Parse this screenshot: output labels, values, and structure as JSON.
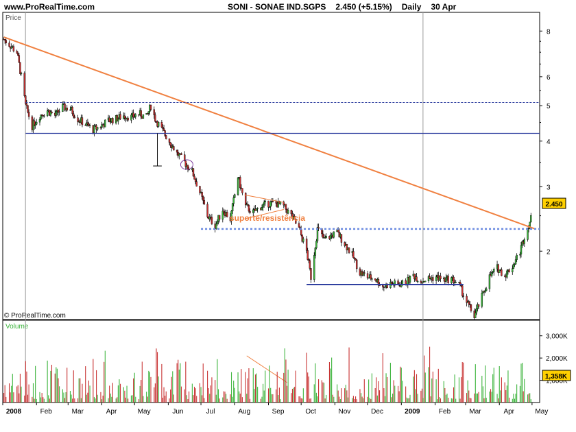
{
  "header": {
    "site": "www.ProRealTime.com",
    "ticker": "SONI - SONAE IND.SGPS",
    "price_change": "2.450 (+5.15%)",
    "period": "Daily",
    "date": "30 Apr"
  },
  "panels": {
    "price_label": "Price",
    "volume_label": "Volume",
    "watermark": "© ProRealTime.com"
  },
  "annotation": {
    "support_text": "suporte/resistência"
  },
  "colors": {
    "up": "#3cb43c",
    "down": "#c83232",
    "trendline": "#f08040",
    "support_line": "#3040a0",
    "dotted_resistance": "#6a8ae0",
    "badge": "#ffd000"
  },
  "badges": {
    "price": "2.450",
    "volume": "1,358K"
  },
  "chart_data": [
    {
      "type": "candlestick",
      "title": "SONI - SONAE IND.SGPS",
      "y_scale": "log",
      "yticks": [
        "2",
        "3",
        "4",
        "5",
        "6",
        "8"
      ],
      "ylim": [
        1.3,
        9.0
      ],
      "x_labels": [
        "2008",
        "Feb",
        "Mar",
        "Apr",
        "May",
        "Jun",
        "Jul",
        "Aug",
        "Sep",
        "Oct",
        "Nov",
        "Dec",
        "2009",
        "Feb",
        "Mar",
        "Apr",
        "May"
      ],
      "close_points": [
        {
          "date": "2008-01-02",
          "close": 7.6
        },
        {
          "date": "2008-01-08",
          "close": 7.3
        },
        {
          "date": "2008-01-14",
          "close": 7.0
        },
        {
          "date": "2008-01-18",
          "close": 6.0
        },
        {
          "date": "2008-01-22",
          "close": 5.0
        },
        {
          "date": "2008-01-28",
          "close": 4.4
        },
        {
          "date": "2008-02-04",
          "close": 4.7
        },
        {
          "date": "2008-02-11",
          "close": 4.85
        },
        {
          "date": "2008-02-18",
          "close": 4.7
        },
        {
          "date": "2008-02-25",
          "close": 4.95
        },
        {
          "date": "2008-03-03",
          "close": 4.9
        },
        {
          "date": "2008-03-10",
          "close": 4.6
        },
        {
          "date": "2008-03-17",
          "close": 4.45
        },
        {
          "date": "2008-03-24",
          "close": 4.3
        },
        {
          "date": "2008-03-31",
          "close": 4.4
        },
        {
          "date": "2008-04-07",
          "close": 4.55
        },
        {
          "date": "2008-04-14",
          "close": 4.6
        },
        {
          "date": "2008-04-21",
          "close": 4.7
        },
        {
          "date": "2008-04-28",
          "close": 4.65
        },
        {
          "date": "2008-05-05",
          "close": 4.75
        },
        {
          "date": "2008-05-12",
          "close": 4.65
        },
        {
          "date": "2008-05-16",
          "close": 5.0
        },
        {
          "date": "2008-05-20",
          "close": 4.6
        },
        {
          "date": "2008-05-26",
          "close": 4.3
        },
        {
          "date": "2008-06-02",
          "close": 4.0
        },
        {
          "date": "2008-06-09",
          "close": 3.7
        },
        {
          "date": "2008-06-16",
          "close": 3.5
        },
        {
          "date": "2008-06-23",
          "close": 3.3
        },
        {
          "date": "2008-06-30",
          "close": 2.9
        },
        {
          "date": "2008-07-07",
          "close": 2.5
        },
        {
          "date": "2008-07-14",
          "close": 2.35
        },
        {
          "date": "2008-07-21",
          "close": 2.6
        },
        {
          "date": "2008-07-28",
          "close": 2.45
        },
        {
          "date": "2008-08-04",
          "close": 3.2
        },
        {
          "date": "2008-08-11",
          "close": 2.65
        },
        {
          "date": "2008-08-18",
          "close": 2.55
        },
        {
          "date": "2008-08-25",
          "close": 2.65
        },
        {
          "date": "2008-09-01",
          "close": 2.7
        },
        {
          "date": "2008-09-08",
          "close": 2.7
        },
        {
          "date": "2008-09-15",
          "close": 2.65
        },
        {
          "date": "2008-09-22",
          "close": 2.5
        },
        {
          "date": "2008-09-29",
          "close": 2.3
        },
        {
          "date": "2008-10-06",
          "close": 2.0
        },
        {
          "date": "2008-10-10",
          "close": 1.7
        },
        {
          "date": "2008-10-16",
          "close": 2.3
        },
        {
          "date": "2008-10-22",
          "close": 2.15
        },
        {
          "date": "2008-10-28",
          "close": 2.2
        },
        {
          "date": "2008-11-03",
          "close": 2.25
        },
        {
          "date": "2008-11-10",
          "close": 2.1
        },
        {
          "date": "2008-11-17",
          "close": 1.95
        },
        {
          "date": "2008-11-24",
          "close": 1.75
        },
        {
          "date": "2008-12-01",
          "close": 1.7
        },
        {
          "date": "2008-12-08",
          "close": 1.68
        },
        {
          "date": "2008-12-15",
          "close": 1.6
        },
        {
          "date": "2008-12-22",
          "close": 1.63
        },
        {
          "date": "2008-12-29",
          "close": 1.62
        },
        {
          "date": "2009-01-05",
          "close": 1.64
        },
        {
          "date": "2009-01-12",
          "close": 1.72
        },
        {
          "date": "2009-01-19",
          "close": 1.66
        },
        {
          "date": "2009-01-26",
          "close": 1.68
        },
        {
          "date": "2009-02-02",
          "close": 1.7
        },
        {
          "date": "2009-02-09",
          "close": 1.67
        },
        {
          "date": "2009-02-16",
          "close": 1.68
        },
        {
          "date": "2009-02-23",
          "close": 1.62
        },
        {
          "date": "2009-03-02",
          "close": 1.45
        },
        {
          "date": "2009-03-09",
          "close": 1.33
        },
        {
          "date": "2009-03-16",
          "close": 1.5
        },
        {
          "date": "2009-03-23",
          "close": 1.7
        },
        {
          "date": "2009-03-30",
          "close": 1.8
        },
        {
          "date": "2009-04-06",
          "close": 1.72
        },
        {
          "date": "2009-04-13",
          "close": 1.82
        },
        {
          "date": "2009-04-20",
          "close": 2.0
        },
        {
          "date": "2009-04-24",
          "close": 2.2
        },
        {
          "date": "2009-04-30",
          "close": 2.45
        }
      ],
      "annotations": {
        "trendline": [
          {
            "date": "2008-01-02",
            "price": 7.7
          },
          {
            "date": "2009-05-04",
            "price": 2.3
          }
        ],
        "resistance_upper_dashed": 5.1,
        "resistance_solid": 4.2,
        "support_dotted": 2.3,
        "support_2009": 1.62,
        "support_2009_range": [
          "2008-10-06",
          "2009-02-27"
        ]
      }
    },
    {
      "type": "bar",
      "title": "Volume",
      "yticks": [
        "1,000K",
        "2,000K",
        "3,000K"
      ],
      "ylim": [
        0,
        3700
      ],
      "last_value": "1,358K"
    }
  ]
}
